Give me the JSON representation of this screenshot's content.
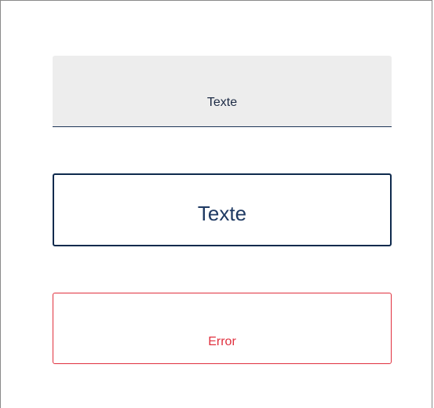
{
  "fields": {
    "filled": {
      "value": "Texte"
    },
    "focused": {
      "value": "Texte"
    },
    "error": {
      "value": "Error"
    }
  },
  "colors": {
    "filled_bg": "#ededed",
    "filled_underline": "#1d3557",
    "focused_border": "#0e2a4d",
    "focused_text": "#1f3a63",
    "error": "#e0303e",
    "frame_border": "#8a8a8a"
  }
}
